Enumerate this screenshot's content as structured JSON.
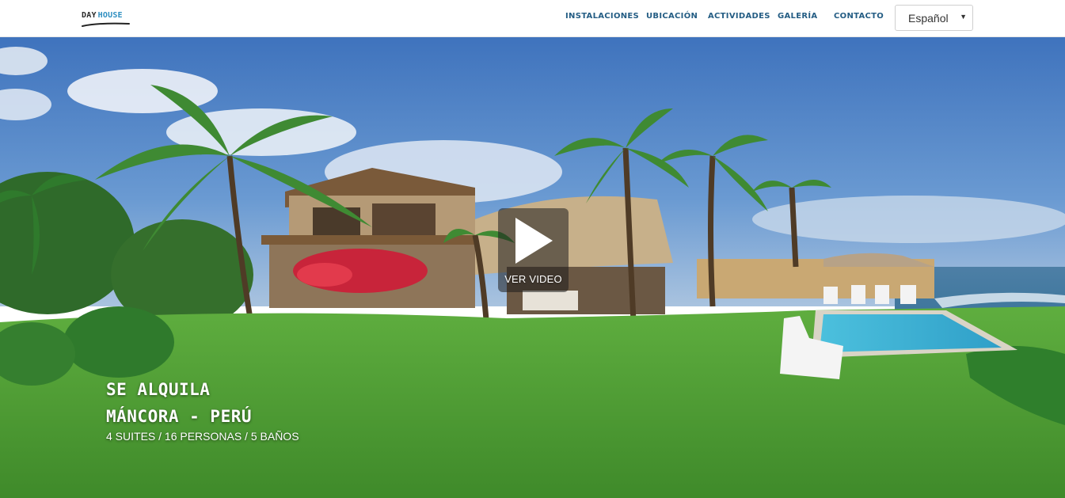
{
  "header": {
    "logo": {
      "part1": "DAY",
      "part2": "HOUSE"
    },
    "nav": [
      {
        "label": "Instalaciones"
      },
      {
        "label": "Ubicación"
      },
      {
        "label": "Actividades"
      },
      {
        "label": "Galería"
      },
      {
        "label": "Contacto"
      }
    ],
    "language_select": {
      "value": "Español"
    }
  },
  "hero": {
    "play_button": {
      "label": "VER VIDEO",
      "icon": "play-icon"
    },
    "title_line1": "SE ALQUILA",
    "title_line2": "MÁNCORA - PERÚ",
    "subtitle": "4 SUITES / 16 PERSONAS / 5 BAÑOS"
  },
  "colors": {
    "nav_link": "#245d84",
    "logo_accent": "#2f8fc1",
    "sky": "#4a80c6",
    "grass": "#56a23a",
    "pool": "#3fb7d6"
  }
}
